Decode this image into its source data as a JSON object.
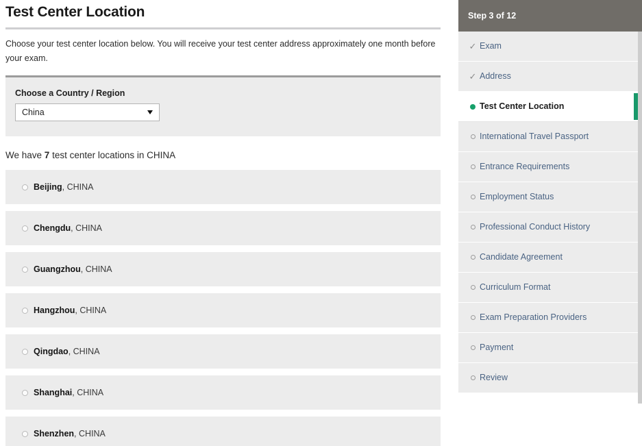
{
  "page": {
    "title": "Test Center Location",
    "intro": "Choose your test center location below. You will receive your test center address approximately one month before your exam."
  },
  "country_selector": {
    "label": "Choose a Country / Region",
    "selected": "China",
    "caret_icon": "chevron-down-icon"
  },
  "results": {
    "prefix": "We have ",
    "count": "7",
    "suffix": " test center locations in CHINA"
  },
  "centers": [
    {
      "city": "Beijing",
      "country": ", CHINA",
      "selected": false
    },
    {
      "city": "Chengdu",
      "country": ", CHINA",
      "selected": false
    },
    {
      "city": "Guangzhou",
      "country": ", CHINA",
      "selected": false
    },
    {
      "city": "Hangzhou",
      "country": ", CHINA",
      "selected": false
    },
    {
      "city": "Qingdao",
      "country": ", CHINA",
      "selected": false
    },
    {
      "city": "Shanghai",
      "country": ", CHINA",
      "selected": false
    },
    {
      "city": "Shenzhen",
      "country": ", CHINA",
      "selected": false
    }
  ],
  "sidebar": {
    "step_header": "Step 3 of 12",
    "check_glyph": "✓",
    "steps": [
      {
        "label": "Exam",
        "state": "complete"
      },
      {
        "label": "Address",
        "state": "complete"
      },
      {
        "label": "Test Center Location",
        "state": "current"
      },
      {
        "label": "International Travel Passport",
        "state": "pending"
      },
      {
        "label": "Entrance Requirements",
        "state": "pending"
      },
      {
        "label": "Employment Status",
        "state": "pending"
      },
      {
        "label": "Professional Conduct History",
        "state": "pending"
      },
      {
        "label": "Candidate Agreement",
        "state": "pending"
      },
      {
        "label": "Curriculum Format",
        "state": "pending"
      },
      {
        "label": "Exam Preparation Providers",
        "state": "pending"
      },
      {
        "label": "Payment",
        "state": "pending"
      },
      {
        "label": "Review",
        "state": "pending"
      }
    ]
  },
  "colors": {
    "header_gray": "#706d68",
    "panel_gray": "#ececec",
    "accent_green": "#18996a",
    "link_blue": "#4a6383"
  }
}
